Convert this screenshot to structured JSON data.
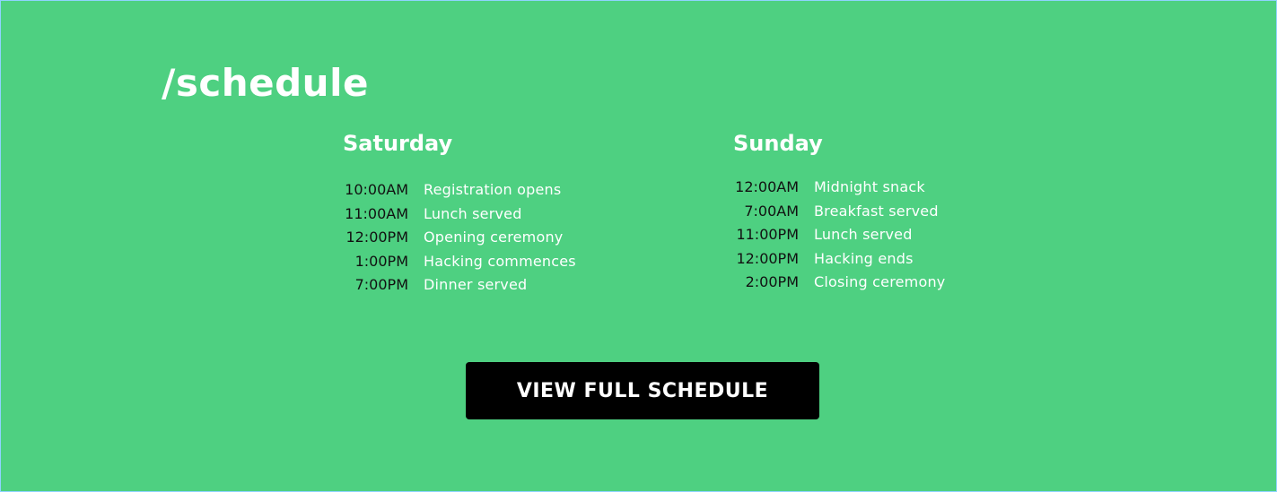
{
  "section": {
    "title": "/schedule",
    "background_color": "#4ed081",
    "accent_text_color": "#ffffff",
    "time_text_color": "#111111"
  },
  "days": [
    {
      "name": "Saturday",
      "events": [
        {
          "time": "10:00AM",
          "label": "Registration opens"
        },
        {
          "time": "11:00AM",
          "label": "Lunch served"
        },
        {
          "time": "12:00PM",
          "label": "Opening ceremony"
        },
        {
          "time": "1:00PM",
          "label": "Hacking commences"
        },
        {
          "time": "7:00PM",
          "label": "Dinner served"
        }
      ]
    },
    {
      "name": "Sunday",
      "events": [
        {
          "time": "12:00AM",
          "label": "Midnight snack"
        },
        {
          "time": "7:00AM",
          "label": "Breakfast served"
        },
        {
          "time": "11:00PM",
          "label": "Lunch served"
        },
        {
          "time": "12:00PM",
          "label": "Hacking ends"
        },
        {
          "time": "2:00PM",
          "label": "Closing ceremony"
        }
      ]
    }
  ],
  "cta": {
    "label": "VIEW FULL SCHEDULE",
    "background_color": "#000000"
  }
}
